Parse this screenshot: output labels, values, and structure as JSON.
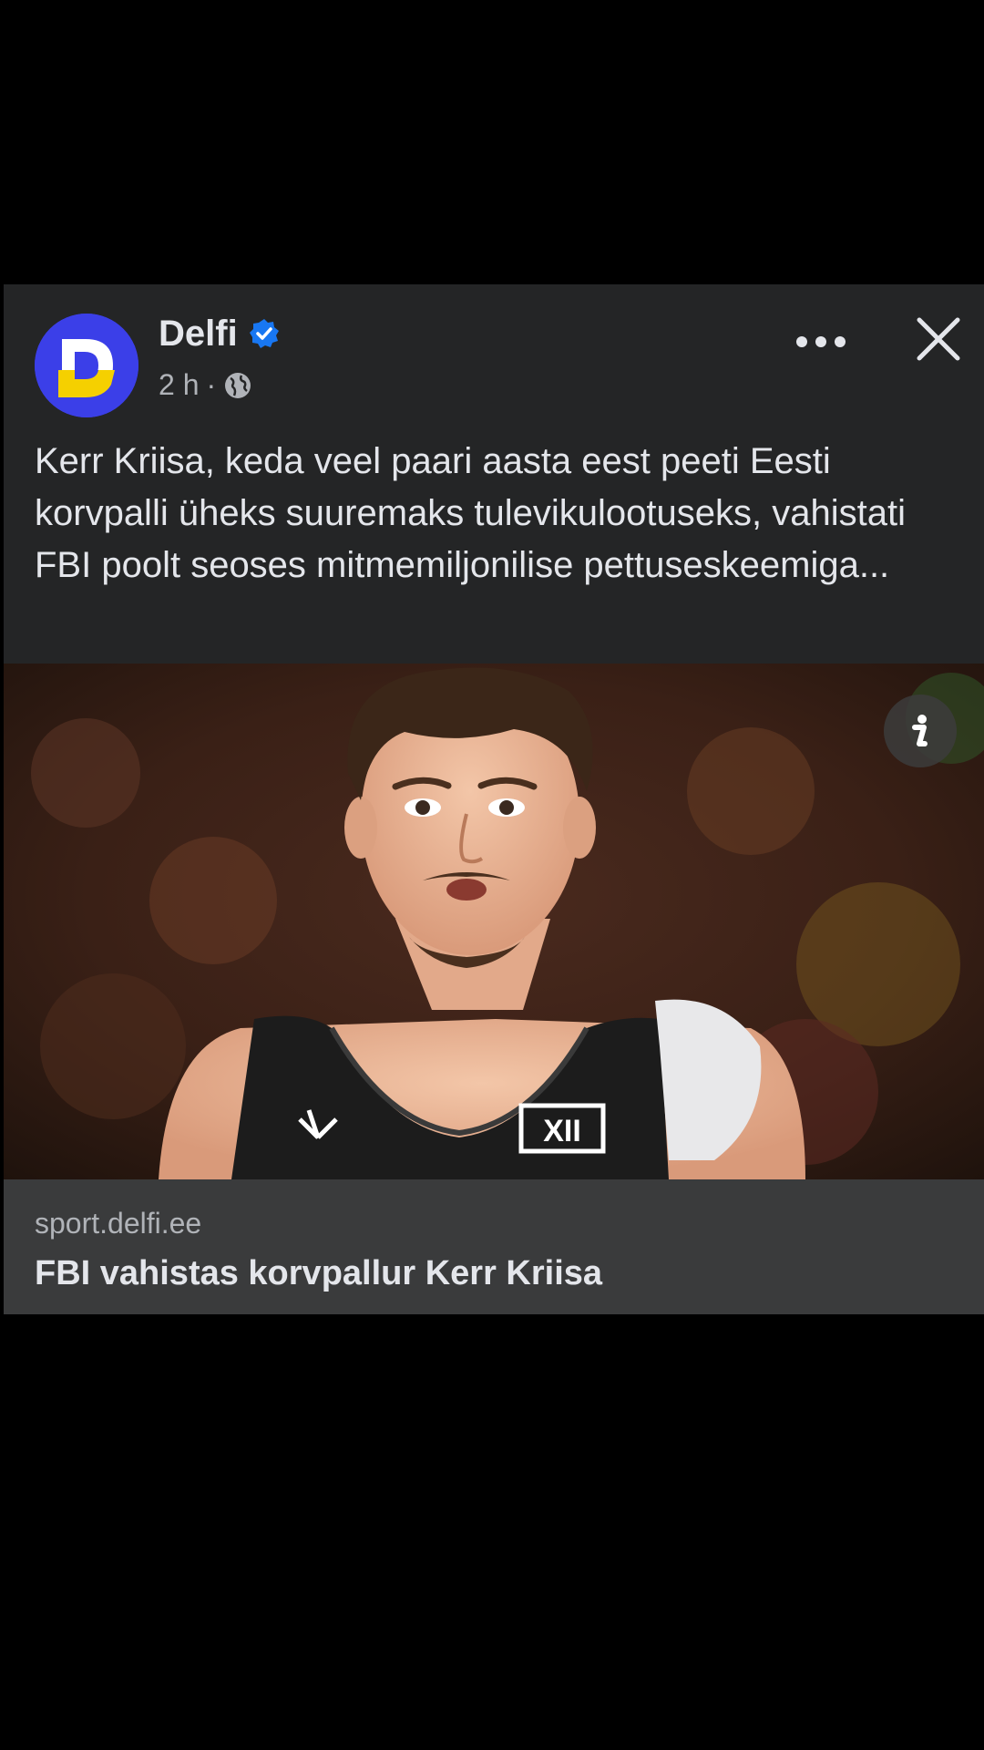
{
  "post": {
    "page_name": "Delfi",
    "verified_icon": "verified-badge-icon",
    "time": "2 h",
    "separator": "·",
    "audience_icon": "globe-icon",
    "caption": "Kerr Kriisa, keda veel paari aasta eest peeti Eesti korvpalli üheks suuremaks tulevikulootuseks, vahistati FBI poolt seoses mitmemiljonilise pettuseskeemiga...",
    "image_icon": "info-icon",
    "link": {
      "domain": "sport.delfi.ee",
      "title": "FBI vahistas korvpallur Kerr Kriisa"
    }
  },
  "colors": {
    "card_background": "#242526",
    "link_background": "#3a3b3c",
    "primary_text": "#e4e6eb",
    "secondary_text": "#b0b3b8",
    "verified_blue": "#1877f2",
    "avatar_blue": "#3b3fe8",
    "avatar_yellow": "#f5d000"
  }
}
